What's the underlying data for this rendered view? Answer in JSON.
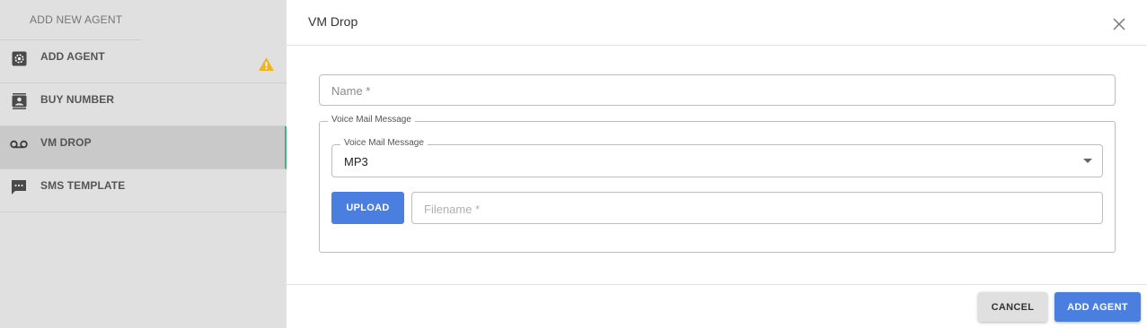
{
  "sidebar": {
    "header": "ADD NEW AGENT",
    "items": [
      {
        "label": "ADD AGENT",
        "icon": "settings-gear-icon",
        "warning": true
      },
      {
        "label": "BUY NUMBER",
        "icon": "contact-card-icon"
      },
      {
        "label": "VM DROP",
        "icon": "voicemail-icon",
        "active": true
      },
      {
        "label": "SMS TEMPLATE",
        "icon": "message-icon"
      }
    ]
  },
  "dialog": {
    "title": "VM Drop",
    "close_icon": "close-icon",
    "name_placeholder": "Name *",
    "voicemail_group_label": "Voice Mail Message",
    "voicemail_select_label": "Voice Mail Message",
    "voicemail_select_value": "MP3",
    "upload_label": "UPLOAD",
    "filename_placeholder": "Filename *"
  },
  "footer": {
    "cancel_label": "CANCEL",
    "add_label": "ADD AGENT"
  },
  "colors": {
    "accent": "#4a7fe0",
    "active_indicator": "#41b47e",
    "warning": "#f0b429",
    "sidebar_bg": "#e0e0e0"
  }
}
